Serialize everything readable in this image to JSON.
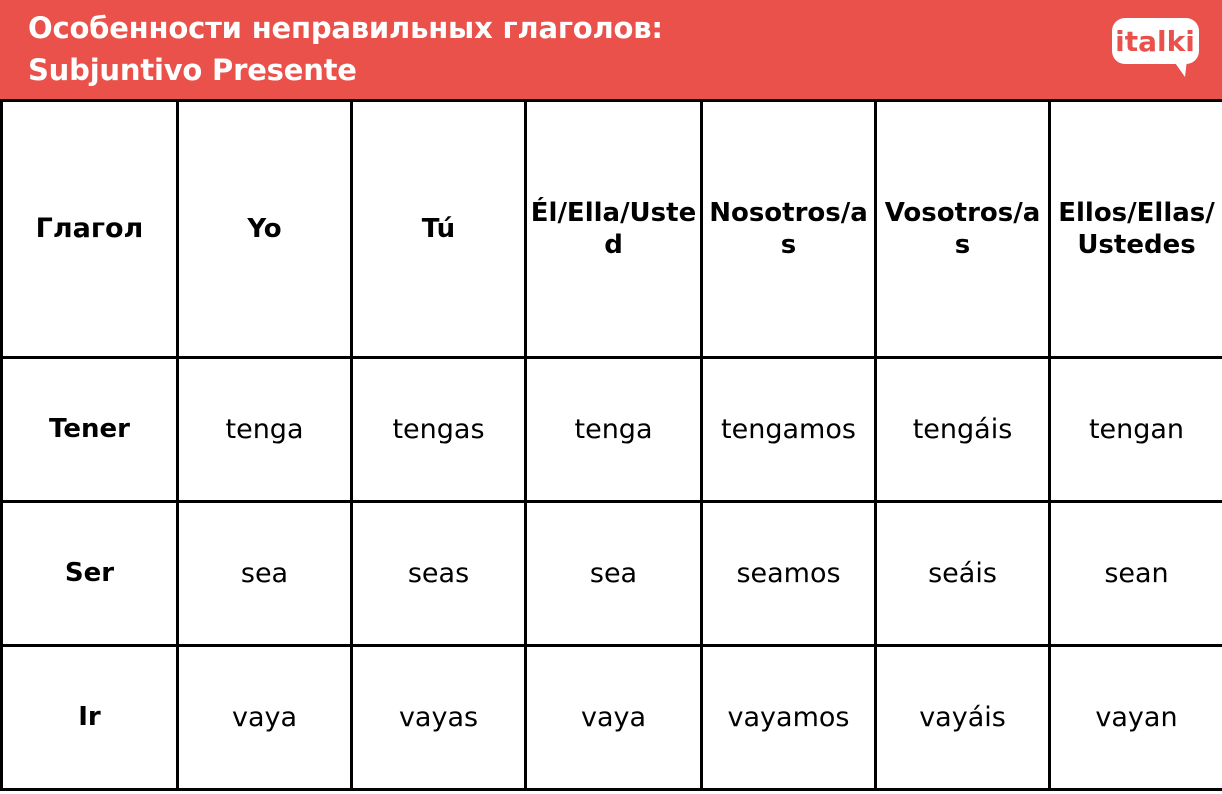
{
  "banner": {
    "title_line1": "Особенности неправильных глаголов:",
    "title_line2": "Subjuntivo Presente",
    "background_color": "#e9514a",
    "text_color": "#ffffff",
    "logo": {
      "name": "italki-logo",
      "text": "italki",
      "bubble_color": "#ffffff",
      "text_color": "#e9514a"
    }
  },
  "table": {
    "headers": [
      "Глагол",
      "Yo",
      "Tú",
      "Él/Ella/\nUsted",
      "Nosotros/\nas",
      "Vosotros/\nas",
      "Ellos/Ellas\n/Ustedes"
    ],
    "headers_flat": {
      "verb": "Глагол",
      "yo": "Yo",
      "tu": "Tú",
      "el_ella_usted": "Él/Ella/Usted",
      "nosotros": "Nosotros/as",
      "vosotros": "Vosotros/as",
      "ellos": "Ellos/Ellas/Ustedes"
    },
    "rows": [
      {
        "verb": "Tener",
        "yo": "tenga",
        "tu": "tengas",
        "el_ella_usted": "tenga",
        "nosotros": "tengamos",
        "vosotros": "tengáis",
        "ellos": "tengan"
      },
      {
        "verb": "Ser",
        "yo": "sea",
        "tu": "seas",
        "el_ella_usted": "sea",
        "nosotros": "seamos",
        "vosotros": "seáis",
        "ellos": "sean"
      },
      {
        "verb": "Ir",
        "yo": "vaya",
        "tu": "vayas",
        "el_ella_usted": "vaya",
        "nosotros": "vayamos",
        "vosotros": "vayáis",
        "ellos": "vayan"
      }
    ],
    "border_color": "#000000"
  }
}
